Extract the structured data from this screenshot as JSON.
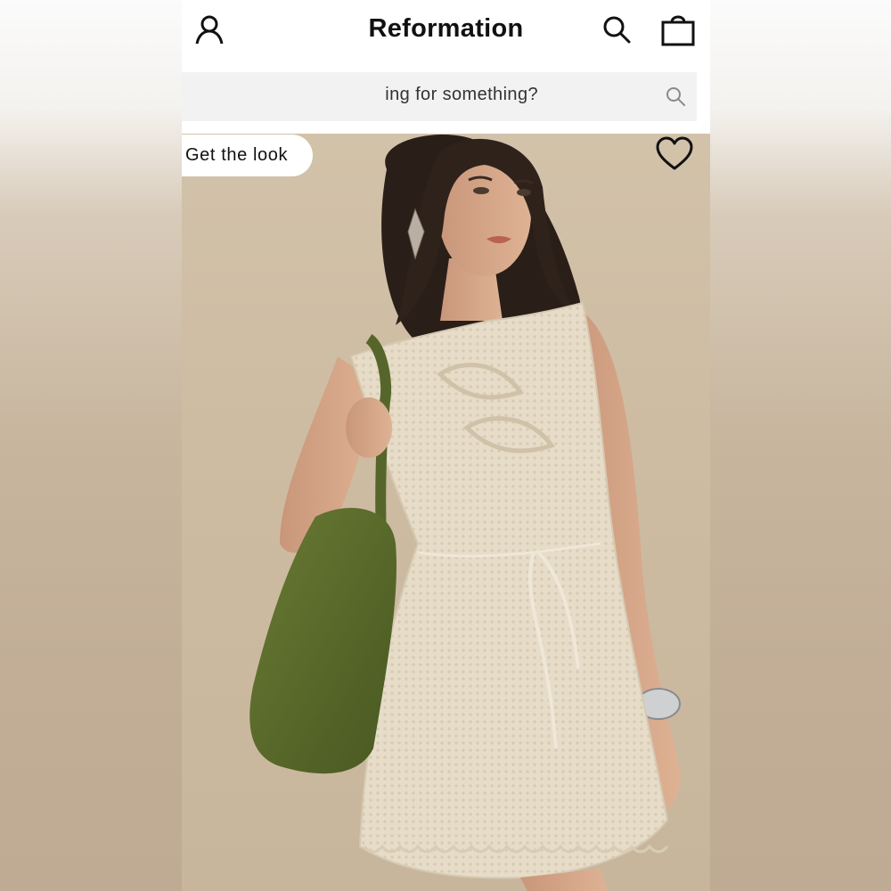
{
  "header": {
    "brand": "Reformation",
    "icons": [
      "account-icon",
      "search-icon",
      "bag-icon"
    ]
  },
  "search": {
    "visible_text": "ing for something?",
    "icon": "search-icon"
  },
  "hero": {
    "get_look_label": "Get the look",
    "favorite_icon": "heart-icon",
    "product_image": "model-in-cream-crochet-mini-dress-with-green-suede-bag"
  },
  "colors": {
    "header_bg": "#ffffff",
    "search_bg": "#f2f2f2",
    "photo_bg": "#cdbca2",
    "dress": "#e8dfcc",
    "bag": "#5b6a2c",
    "text": "#111111"
  }
}
